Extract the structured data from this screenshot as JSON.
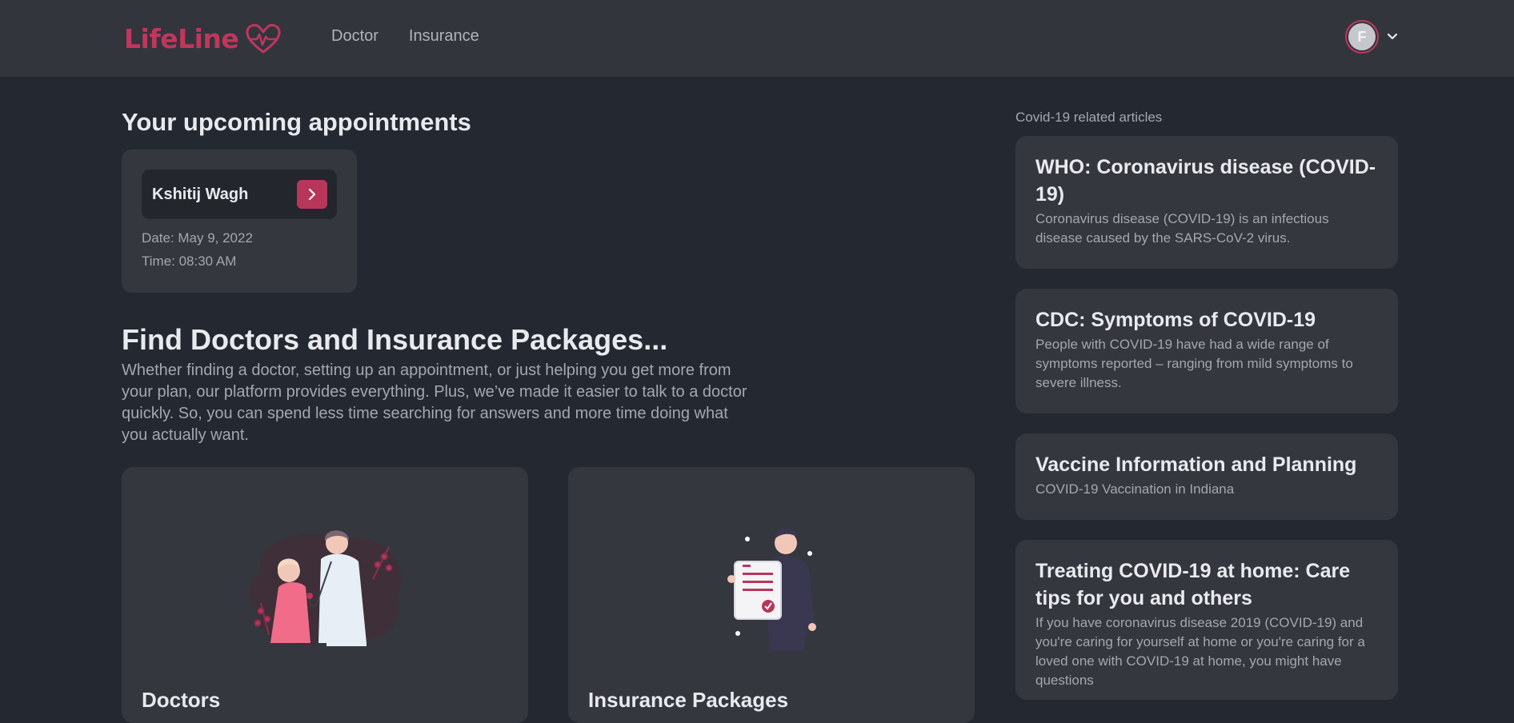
{
  "header": {
    "brand": "LifeLine",
    "nav": [
      {
        "label": "Doctor"
      },
      {
        "label": "Insurance"
      }
    ],
    "user_initial": "F"
  },
  "appointments": {
    "heading": "Your upcoming appointments",
    "items": [
      {
        "doctor": "Kshitij Wagh",
        "date": "Date: May 9, 2022",
        "time": "Time: 08:30 AM"
      }
    ]
  },
  "find": {
    "heading": "Find Doctors and Insurance Packages...",
    "description": "Whether finding a doctor, setting up an appointment, or just helping you get more from your plan, our platform provides everything. Plus, we’ve made it easier to talk to a doctor quickly. So, you can spend less time searching for answers and more time doing what you actually want.",
    "cards": [
      {
        "title": "Doctors",
        "illustration": "doctor-patient-illustration"
      },
      {
        "title": "Insurance Packages",
        "illustration": "insurance-document-illustration"
      }
    ]
  },
  "articles": {
    "label": "Covid-19 related articles",
    "items": [
      {
        "title": "WHO: Coronavirus disease (COVID-19)",
        "desc": "Coronavirus disease (COVID-19) is an infectious disease caused by the SARS-CoV-2 virus."
      },
      {
        "title": "CDC: Symptoms of COVID-19",
        "desc": "People with COVID-19 have had a wide range of symptoms reported – ranging from mild symptoms to severe illness."
      },
      {
        "title": "Vaccine Information and Planning",
        "desc": "COVID-19 Vaccination in Indiana"
      },
      {
        "title": "Treating COVID-19 at home: Care tips for you and others",
        "desc": "If you have coronavirus disease 2019 (COVID-19) and you're caring for yourself at home or you're caring for a loved one with COVID-19 at home, you might have questions"
      }
    ]
  },
  "colors": {
    "accent": "#c0365c",
    "background": "#242830",
    "card": "#34373e",
    "header": "#32353c"
  }
}
